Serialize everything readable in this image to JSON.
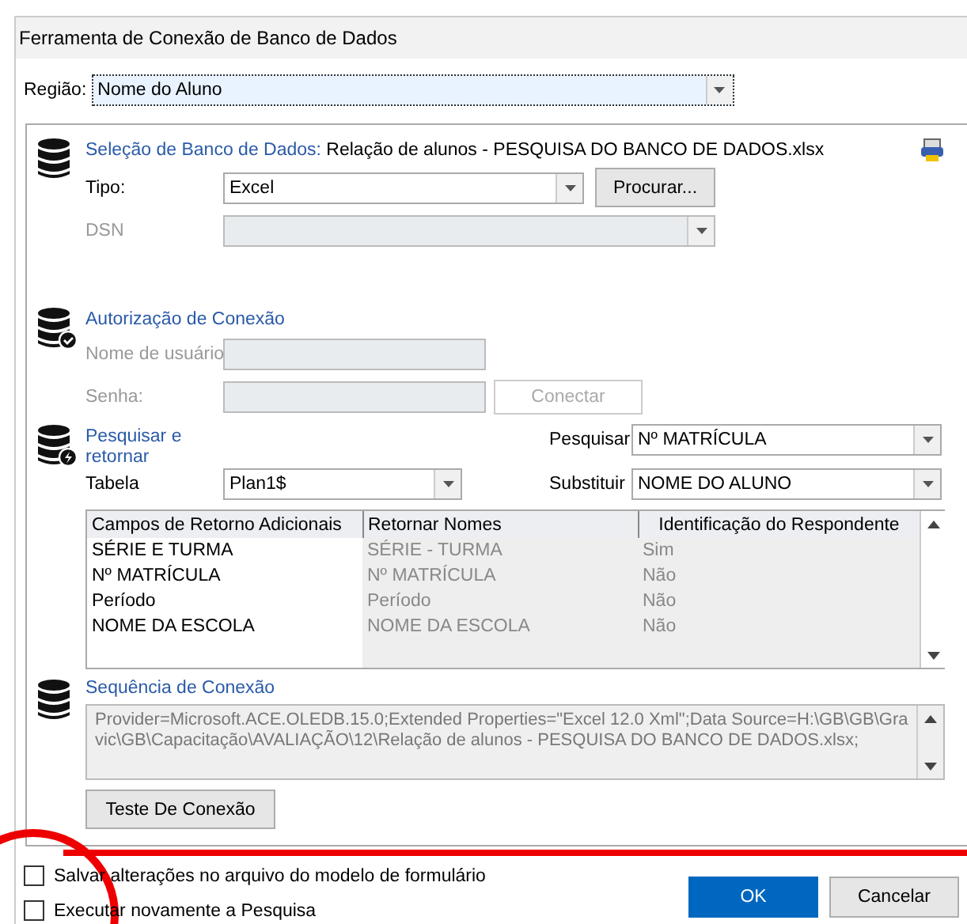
{
  "window": {
    "title": "Ferramenta de Conexão de Banco de Dados"
  },
  "region": {
    "label": "Região:",
    "value": "Nome do Aluno"
  },
  "database_selection": {
    "heading": "Seleção de Banco de Dados:",
    "file": "Relação de alunos - PESQUISA DO BANCO DE DADOS.xlsx",
    "type_label": "Tipo:",
    "type_value": "Excel",
    "browse_button": "Procurar...",
    "dsn_label": "DSN",
    "dsn_disabled": true
  },
  "authorization": {
    "heading": "Autorização de Conexão",
    "username_label": "Nome de usuário",
    "password_label": "Senha:",
    "connect_button": "Conectar",
    "disabled": true
  },
  "search": {
    "heading": "Pesquisar e retornar",
    "table_label": "Tabela",
    "table_value": "Plan1$",
    "search_label": "Pesquisar",
    "search_value": "Nº MATRÍCULA",
    "replace_label": "Substituir",
    "replace_value": "NOME DO ALUNO"
  },
  "return_fields": {
    "columns": [
      "Campos de Retorno Adicionais",
      "Retornar Nomes",
      "Identificação do Respondente"
    ],
    "rows": [
      {
        "field": "SÉRIE E TURMA",
        "return_name": "SÉRIE - TURMA",
        "respondent_id": "Sim"
      },
      {
        "field": "Nº MATRÍCULA",
        "return_name": "Nº MATRÍCULA",
        "respondent_id": "Não"
      },
      {
        "field": "Período",
        "return_name": "Período",
        "respondent_id": "Não"
      },
      {
        "field": "NOME DA ESCOLA",
        "return_name": "NOME DA ESCOLA",
        "respondent_id": "Não"
      }
    ]
  },
  "connection_string": {
    "heading": "Sequência de Conexão",
    "value": "Provider=Microsoft.ACE.OLEDB.15.0;Extended Properties=\"Excel 12.0 Xml\";Data Source=H:\\GB\\GB\\Gravic\\GB\\Capacitação\\AVALIAÇÃO\\12\\Relação de alunos - PESQUISA DO BANCO DE DADOS.xlsx;",
    "test_button": "Teste De Conexão"
  },
  "options": [
    {
      "label": "Salvar alterações no arquivo do modelo de formulário",
      "checked": false
    },
    {
      "label": "Executar novamente a Pesquisa",
      "checked": false
    }
  ],
  "buttons": [
    {
      "label": "OK",
      "kind": "primary"
    },
    {
      "label": "Cancelar",
      "kind": "secondary"
    }
  ]
}
